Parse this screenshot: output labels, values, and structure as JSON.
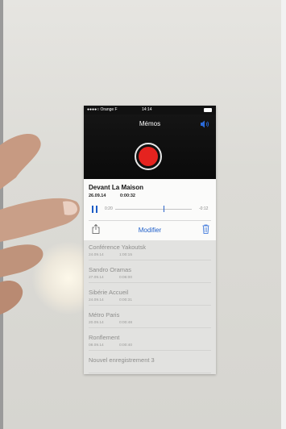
{
  "status_bar": {
    "carrier": "●●●●○ Orange F",
    "time": "14:14"
  },
  "recorder": {
    "title": "Mémos"
  },
  "selected_memo": {
    "name": "Devant La Maison",
    "date": "26.09.14",
    "duration": "0:00:32",
    "elapsed": "0:20",
    "remaining": "-0:12",
    "progress_fraction": 0.63,
    "edit_label": "Modifier"
  },
  "memos": [
    {
      "title": "Conférence Yakoutsk",
      "date": "24.09.14",
      "duration": "1:00:15"
    },
    {
      "title": "Sandro Oramas",
      "date": "27.09.14",
      "duration": "0:06:00"
    },
    {
      "title": "Sibérie Accueil",
      "date": "24.09.14",
      "duration": "0:00:31"
    },
    {
      "title": "Métro Paris",
      "date": "20.09.14",
      "duration": "0:00:48"
    },
    {
      "title": "Ronflement",
      "date": "08.09.14",
      "duration": "0:00:40"
    },
    {
      "title": "Nouvel enregistrement 3",
      "date": "",
      "duration": ""
    }
  ],
  "colors": {
    "record": "#e5231f",
    "accent": "#1f5fc9"
  },
  "icons": [
    "speaker-icon",
    "record-icon",
    "pause-icon",
    "share-icon",
    "trash-icon"
  ]
}
